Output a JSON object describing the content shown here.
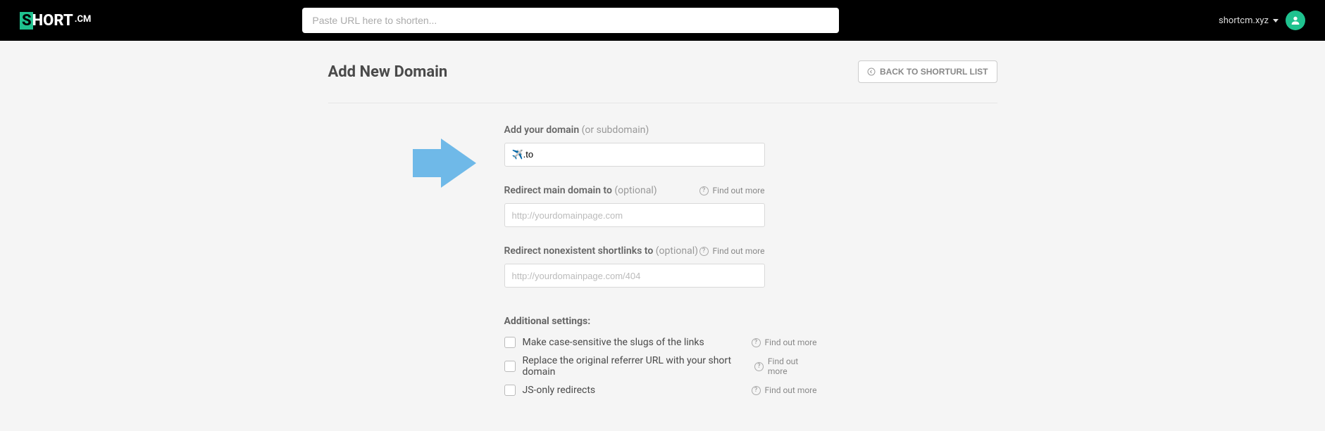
{
  "header": {
    "logo_mark": "S",
    "logo_text": "HORT",
    "logo_suffix": ".CM",
    "url_placeholder": "Paste URL here to shorten...",
    "domain_selector": "shortcm.xyz"
  },
  "page": {
    "title": "Add New Domain",
    "back_button": "BACK TO SHORTURL LIST"
  },
  "form": {
    "domain": {
      "label": "Add your domain",
      "optional": "(or subdomain)",
      "value": "✈️.to"
    },
    "redirect_main": {
      "label": "Redirect main domain to",
      "optional": "(optional)",
      "placeholder": "http://yourdomainpage.com",
      "help": "Find out more"
    },
    "redirect_404": {
      "label": "Redirect nonexistent shortlinks to",
      "optional": "(optional)",
      "placeholder": "http://yourdomainpage.com/404",
      "help": "Find out more"
    }
  },
  "settings": {
    "title": "Additional settings:",
    "help": "Find out more",
    "items": [
      "Make case-sensitive the slugs of the links",
      "Replace the original referrer URL with your short domain",
      "JS-only redirects"
    ]
  }
}
